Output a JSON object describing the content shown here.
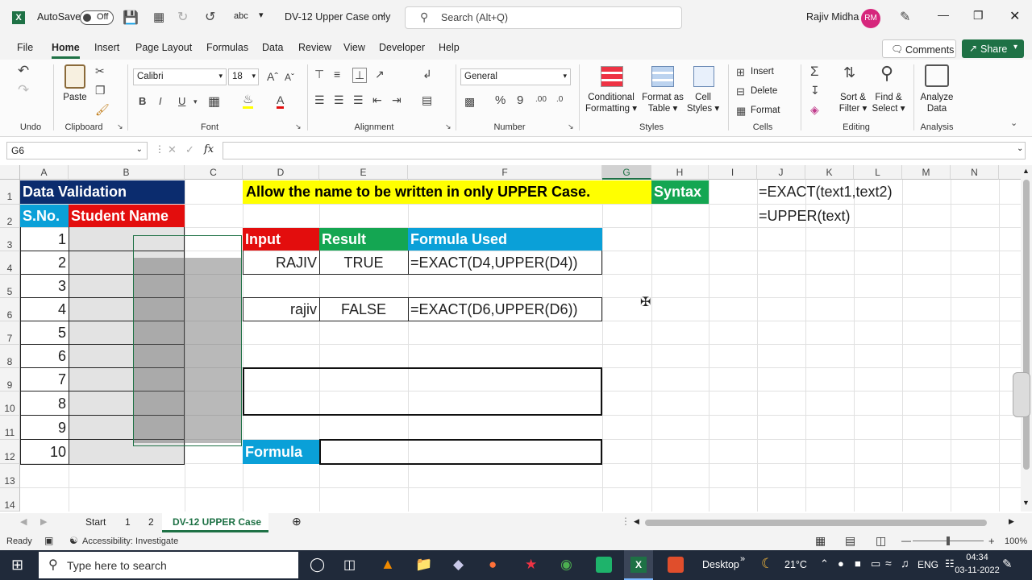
{
  "titlebar": {
    "autosave_label": "AutoSave",
    "autosave_state": "Off",
    "filename": "DV-12 Upper Case only",
    "search_placeholder": "Search (Alt+Q)",
    "user_name": "Rajiv Midha",
    "user_initials": "RM"
  },
  "menu": {
    "items": [
      "File",
      "Home",
      "Insert",
      "Page Layout",
      "Formulas",
      "Data",
      "Review",
      "View",
      "Developer",
      "Help"
    ],
    "active": "Home",
    "comments_label": "Comments",
    "share_label": "Share"
  },
  "ribbon": {
    "groups": [
      "Undo",
      "Clipboard",
      "Font",
      "Alignment",
      "Number",
      "Styles",
      "Cells",
      "Editing",
      "Analysis"
    ],
    "paste": "Paste",
    "font_name": "Calibri",
    "font_size": "18",
    "number_format": "General",
    "conditional_formatting": [
      "Conditional",
      "Formatting"
    ],
    "format_as_table": [
      "Format as",
      "Table"
    ],
    "cell_styles": [
      "Cell",
      "Styles"
    ],
    "insert": "Insert",
    "delete": "Delete",
    "format": "Format",
    "sort_filter": [
      "Sort &",
      "Filter"
    ],
    "find_select": [
      "Find &",
      "Select"
    ],
    "analyze_data": [
      "Analyze",
      "Data"
    ],
    "bold": "B",
    "italic": "I",
    "underline": "U",
    "font_color": "A"
  },
  "formula_bar": {
    "name_box": "G6",
    "fx": "fx",
    "value": ""
  },
  "columns": [
    "A",
    "B",
    "C",
    "D",
    "E",
    "F",
    "G",
    "H",
    "I",
    "J",
    "K",
    "L",
    "M",
    "N"
  ],
  "rows": [
    "1",
    "2",
    "3",
    "4",
    "5",
    "6",
    "7",
    "8",
    "9",
    "10",
    "11",
    "12",
    "13",
    "14"
  ],
  "selected_column": "G",
  "cells": {
    "title": "Data Validation",
    "col_sno": "S.No.",
    "col_student": "Student Name",
    "sno": [
      "1",
      "2",
      "3",
      "4",
      "5",
      "6",
      "7",
      "8",
      "9",
      "10"
    ],
    "banner": "Allow the name to be written in only UPPER Case.",
    "syntax": "Syntax",
    "syntax1": "=EXACT(text1,text2)",
    "syntax2": "=UPPER(text)",
    "hdr_input": "Input",
    "hdr_result": "Result",
    "hdr_formula": "Formula Used",
    "r4_input": "RAJIV",
    "r4_result": "TRUE",
    "r4_formula": "=EXACT(D4,UPPER(D4))",
    "r6_input": "rajiv",
    "r6_result": "FALSE",
    "r6_formula": "=EXACT(D6,UPPER(D6))",
    "formula_label": "Formula"
  },
  "colors": {
    "navy": "#0b2c6e",
    "sky": "#0aa0d8",
    "red": "#e30d0d",
    "yellow": "#ffff00",
    "green": "#14a652",
    "excel_green": "#1e7145"
  },
  "sheet_tabs": {
    "items": [
      "Start",
      "1",
      "2",
      "DV-12 UPPER Case"
    ],
    "active": "DV-12 UPPER Case"
  },
  "status": {
    "ready": "Ready",
    "accessibility": "Accessibility: Investigate",
    "zoom": "100%"
  },
  "taskbar": {
    "search_placeholder": "Type here to search",
    "desktop": "Desktop",
    "weather": "21°C",
    "language": "ENG",
    "time": "04:34",
    "date": "03-11-2022"
  }
}
